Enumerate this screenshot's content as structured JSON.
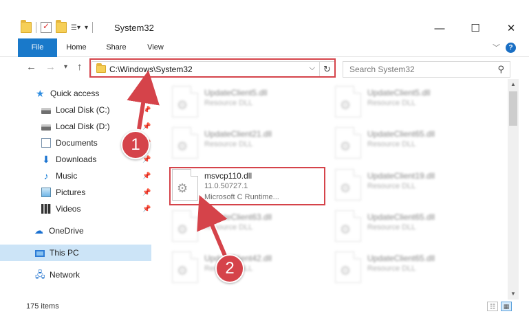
{
  "window": {
    "title": "System32"
  },
  "ribbon": {
    "tabs": [
      "File",
      "Home",
      "Share",
      "View"
    ],
    "help_label": "?"
  },
  "address": {
    "path": "C:\\Windows\\System32"
  },
  "search": {
    "placeholder": "Search System32"
  },
  "sidebar": {
    "items": [
      {
        "label": "Quick access",
        "icon": "star-icon"
      },
      {
        "label": "Local Disk (C:)",
        "icon": "disk-icon",
        "pinned": true
      },
      {
        "label": "Local Disk (D:)",
        "icon": "disk-icon",
        "pinned": true
      },
      {
        "label": "Documents",
        "icon": "documents-icon",
        "pinned": true
      },
      {
        "label": "Downloads",
        "icon": "downloads-icon",
        "pinned": true
      },
      {
        "label": "Music",
        "icon": "music-icon",
        "pinned": true
      },
      {
        "label": "Pictures",
        "icon": "pictures-icon",
        "pinned": true
      },
      {
        "label": "Videos",
        "icon": "videos-icon",
        "pinned": true
      },
      {
        "label": "OneDrive",
        "icon": "cloud-icon"
      },
      {
        "label": "This PC",
        "icon": "computer-icon",
        "selected": true
      },
      {
        "label": "Network",
        "icon": "network-icon"
      }
    ]
  },
  "files": [
    {
      "name": "UpdateClient5.dll",
      "type": "Resource DLL"
    },
    {
      "name": "UpdateClient5.dll",
      "type": "Resource DLL"
    },
    {
      "name": "UpdateClient21.dll",
      "type": "Resource DLL"
    },
    {
      "name": "UpdateClient65.dll",
      "type": "Resource DLL"
    },
    {
      "name": "msvcp110.dll",
      "type": "11.0.50727.1",
      "desc": "Microsoft C Runtime..."
    },
    {
      "name": "UpdateClient19.dll",
      "type": "Resource DLL"
    },
    {
      "name": "UpdateClient63.dll",
      "type": "Resource DLL"
    },
    {
      "name": "UpdateClient65.dll",
      "type": "Resource DLL"
    },
    {
      "name": "UpdateClient42.dll",
      "type": "Resource DLL"
    },
    {
      "name": "UpdateClient65.dll",
      "type": "Resource DLL"
    }
  ],
  "status": {
    "item_count": "175 items"
  },
  "callouts": {
    "step1": "1",
    "step2": "2"
  },
  "colors": {
    "accent": "#1979ca",
    "highlight": "#d5434a"
  }
}
